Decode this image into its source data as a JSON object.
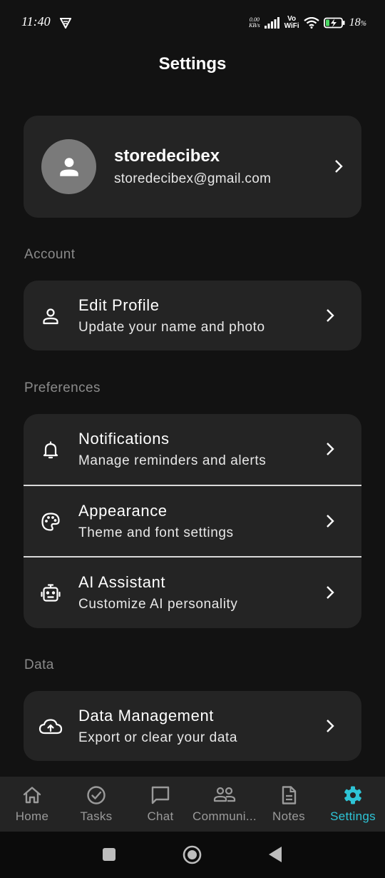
{
  "status": {
    "time": "11:40",
    "net_speed_value": "0.00",
    "net_speed_unit": "KB/s",
    "volte_top": "Vo",
    "volte_bottom": "WiFi",
    "battery": "18",
    "battery_unit": "%"
  },
  "header": {
    "title": "Settings"
  },
  "profile": {
    "name": "storedecibex",
    "email": "storedecibex@gmail.com"
  },
  "sections": {
    "account": "Account",
    "preferences": "Preferences",
    "data": "Data"
  },
  "items": {
    "edit_profile": {
      "title": "Edit Profile",
      "subtitle": "Update your name and photo",
      "icon": "person-icon"
    },
    "notifications": {
      "title": "Notifications",
      "subtitle": "Manage reminders and alerts",
      "icon": "bell-icon"
    },
    "appearance": {
      "title": "Appearance",
      "subtitle": "Theme and font settings",
      "icon": "palette-icon"
    },
    "ai_assistant": {
      "title": "AI Assistant",
      "subtitle": "Customize AI personality",
      "icon": "robot-icon"
    },
    "data_management": {
      "title": "Data Management",
      "subtitle": "Export or clear your data",
      "icon": "cloud-upload-icon"
    }
  },
  "nav": [
    {
      "label": "Home",
      "icon": "home-icon"
    },
    {
      "label": "Tasks",
      "icon": "check-circle-icon"
    },
    {
      "label": "Chat",
      "icon": "chat-icon"
    },
    {
      "label": "Communi...",
      "icon": "community-icon"
    },
    {
      "label": "Notes",
      "icon": "notes-icon"
    },
    {
      "label": "Settings",
      "icon": "gear-icon",
      "active": true
    }
  ],
  "colors": {
    "background": "#121212",
    "card": "#242424",
    "accent": "#2ec4d6",
    "muted": "#8a8a8a"
  }
}
